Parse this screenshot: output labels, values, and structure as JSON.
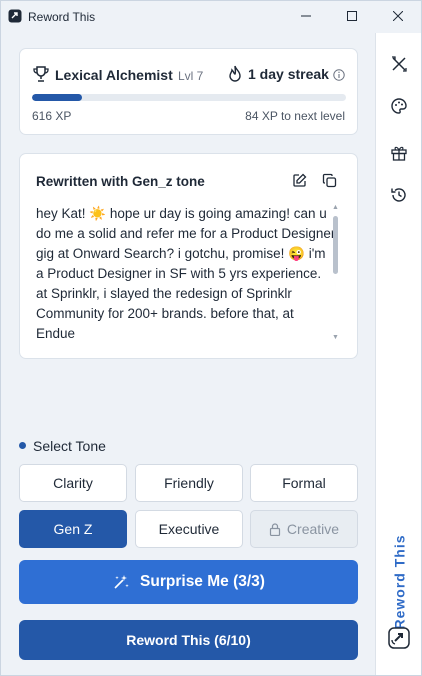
{
  "window": {
    "title": "Reword This",
    "controls": [
      "minimize-icon",
      "maximize-icon",
      "close-icon"
    ]
  },
  "level": {
    "name": "Lexical Alchemist",
    "level_label": "Lvl 7",
    "streak_label": "1 day streak",
    "xp_current": "616 XP",
    "xp_next": "84 XP to next level",
    "progress": 0.16
  },
  "result": {
    "title": "Rewritten with Gen_z tone",
    "text": "hey Kat! ☀️ hope ur day is going amazing! can u do me a solid and refer me for a Product Designer gig at Onward Search? i gotchu, promise! 😜 i'm a Product Designer in SF with 5 yrs experience. at Sprinklr, i slayed the redesign of Sprinklr Community for 200+ brands. before that, at Endue"
  },
  "tones": {
    "header": "Select Tone",
    "options": [
      {
        "label": "Clarity",
        "state": "default"
      },
      {
        "label": "Friendly",
        "state": "default"
      },
      {
        "label": "Formal",
        "state": "default"
      },
      {
        "label": "Gen Z",
        "state": "selected"
      },
      {
        "label": "Executive",
        "state": "default"
      },
      {
        "label": "Creative",
        "state": "locked"
      }
    ]
  },
  "actions": {
    "surprise_label": "Surprise Me (3/3)",
    "reword_label": "Reword This (6/10)"
  },
  "sidebar": {
    "items": [
      "tools-icon",
      "palette-icon",
      "gift-icon",
      "history-icon"
    ],
    "vertical_label": "Reword This"
  },
  "colors": {
    "primary": "#2458a8",
    "accent": "#2f6fd4",
    "background": "#eef2f7"
  }
}
